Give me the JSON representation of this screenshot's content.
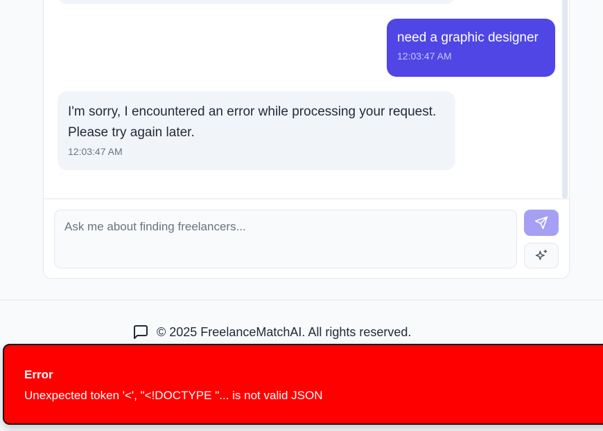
{
  "chat": {
    "messages": [
      {
        "role": "user",
        "text": "need a graphic designer",
        "time": "12:03:47 AM"
      },
      {
        "role": "assistant",
        "text": "I'm sorry, I encountered an error while processing your request. Please try again later.",
        "time": "12:03:47 AM"
      }
    ],
    "input_placeholder": "Ask me about finding freelancers...",
    "input_value": "",
    "send_icon": "send-icon",
    "magic_icon": "sparkles-icon"
  },
  "footer": {
    "icon": "message-square-icon",
    "copyright": "© 2025 FreelanceMatchAI. All rights reserved."
  },
  "toast": {
    "title": "Error",
    "message": "Unexpected token '<', \"<!DOCTYPE \"... is not valid JSON"
  },
  "colors": {
    "accent": "#4f46e5",
    "accent_disabled": "#a5a0f4",
    "toast_bg": "#ff0000",
    "bubble_bg": "#f1f5f9"
  }
}
